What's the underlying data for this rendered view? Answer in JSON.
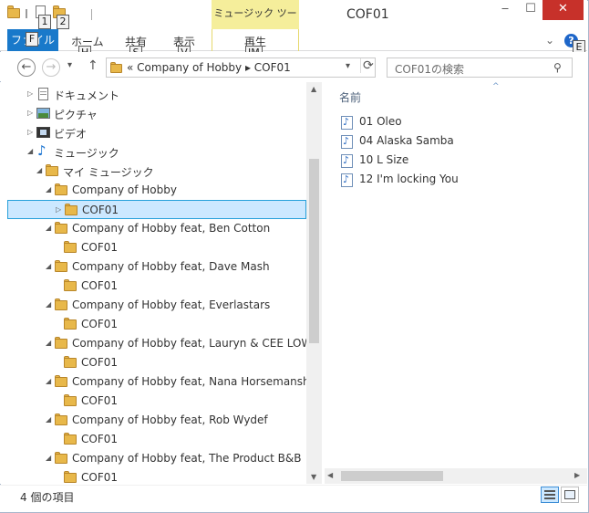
{
  "title": {
    "window_title": "COF01",
    "contextual_tab_group": "ミュージック ツール",
    "qat_keytips": [
      "1",
      "2"
    ],
    "minimize": "‒",
    "restore": "☐",
    "close": "✕"
  },
  "ribbon": {
    "file_tab": "ファイル",
    "file_keytip": "F",
    "tabs": [
      {
        "label": "ホーム",
        "keytip": "H"
      },
      {
        "label": "共有",
        "keytip": "S"
      },
      {
        "label": "表示",
        "keytip": "V"
      },
      {
        "label": "再生",
        "keytip": "JM"
      }
    ],
    "help_keytip": "E",
    "expand_icon": "chevron-down-icon",
    "help_icon": "help-icon"
  },
  "nav": {
    "back": "←",
    "forward": "→",
    "recent": "▾",
    "up": "↑",
    "address": "« Company of Hobby  ▸  COF01",
    "refresh": "⟳",
    "search_placeholder": "COF01の検索"
  },
  "tree": [
    {
      "label": "ドキュメント",
      "icon": "documents-icon",
      "arrow": "collapsed"
    },
    {
      "label": "ピクチャ",
      "icon": "pictures-icon",
      "arrow": "collapsed"
    },
    {
      "label": "ビデオ",
      "icon": "videos-icon",
      "arrow": "collapsed"
    },
    {
      "label": "ミュージック",
      "icon": "music-library-icon",
      "arrow": "expanded"
    },
    {
      "label": "マイ ミュージック",
      "icon": "folder-icon",
      "arrow": "expanded"
    },
    {
      "label": "Company of Hobby",
      "icon": "folder-icon",
      "arrow": "expanded"
    },
    {
      "label": "COF01",
      "icon": "folder-icon",
      "arrow": "collapsed",
      "selected": true
    },
    {
      "label": "Company of Hobby feat, Ben Cotton",
      "icon": "folder-icon",
      "arrow": "expanded"
    },
    {
      "label": "COF01",
      "icon": "folder-icon",
      "arrow": "none"
    },
    {
      "label": "Company of Hobby feat, Dave Mash",
      "icon": "folder-icon",
      "arrow": "expanded"
    },
    {
      "label": "COF01",
      "icon": "folder-icon",
      "arrow": "none"
    },
    {
      "label": "Company of Hobby feat, Everlastars",
      "icon": "folder-icon",
      "arrow": "expanded"
    },
    {
      "label": "COF01",
      "icon": "folder-icon",
      "arrow": "none"
    },
    {
      "label": "Company of Hobby feat, Lauryn & CEE LOW",
      "icon": "folder-icon",
      "arrow": "expanded"
    },
    {
      "label": "COF01",
      "icon": "folder-icon",
      "arrow": "none"
    },
    {
      "label": "Company of Hobby feat, Nana Horsemanshi",
      "icon": "folder-icon",
      "arrow": "expanded"
    },
    {
      "label": "COF01",
      "icon": "folder-icon",
      "arrow": "none"
    },
    {
      "label": "Company of Hobby feat, Rob Wydef",
      "icon": "folder-icon",
      "arrow": "expanded"
    },
    {
      "label": "COF01",
      "icon": "folder-icon",
      "arrow": "none"
    },
    {
      "label": "Company of Hobby feat, The Product B&B",
      "icon": "folder-icon",
      "arrow": "expanded"
    },
    {
      "label": "COF01",
      "icon": "folder-icon",
      "arrow": "none"
    }
  ],
  "content": {
    "column_header": "名前",
    "files": [
      {
        "label": "01 Oleo",
        "icon": "music-file-icon"
      },
      {
        "label": "04 Alaska Samba",
        "icon": "music-file-icon"
      },
      {
        "label": "10 L Size",
        "icon": "music-file-icon"
      },
      {
        "label": "12 I'm locking You",
        "icon": "music-file-icon"
      }
    ]
  },
  "status": {
    "item_count": "4 個の項目"
  },
  "colors": {
    "accent": "#1979ca",
    "contextual_tab": "#f5ee9b",
    "close": "#c7312a",
    "selection": "#cce8ff",
    "folder": "#e8b84a"
  }
}
